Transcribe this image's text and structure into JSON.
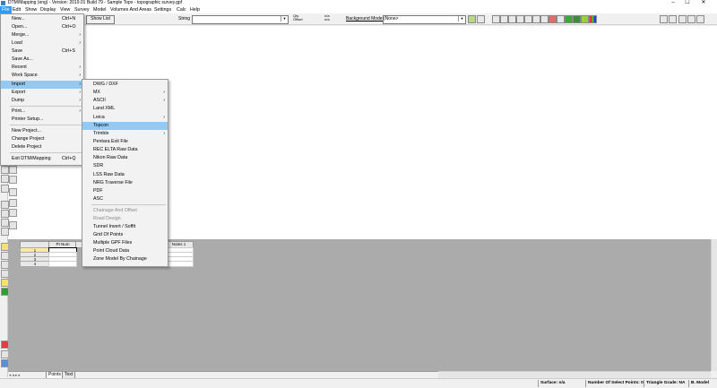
{
  "window": {
    "title": "DTM/Mapping (eng) - Version: 2019.01 Build 79 - Sample Topo - topographic survey.gpf",
    "minimize": "–",
    "maximize": "☐",
    "close": "✕"
  },
  "menubar": [
    "File",
    "Edit",
    "Show",
    "Display",
    "View",
    "Survey",
    "Model",
    "Volumes And Areas",
    "Settings",
    "Calc",
    "Help"
  ],
  "toolbar": {
    "show_list": "Show List",
    "string_label": "String",
    "string_value": "",
    "offset_label_top": "Qty",
    "offset_label_bottom": "Offset",
    "na_top": "n/a",
    "na_bottom": "n/a",
    "background_model_label": "Background Model",
    "background_model_value": "(None>"
  },
  "file_menu": [
    {
      "label": "New...",
      "shortcut": "Ctrl+N"
    },
    {
      "label": "Open...",
      "shortcut": "Ctrl+O"
    },
    {
      "label": "Merge...",
      "arrow": "›"
    },
    {
      "label": "Load",
      "arrow": "›"
    },
    {
      "label": "Save",
      "shortcut": "Ctrl+S"
    },
    {
      "label": "Save As..."
    },
    {
      "label": "Recent",
      "arrow": "›"
    },
    {
      "label": "Work Space",
      "arrow": "›"
    },
    {
      "label": "Import",
      "arrow": "›",
      "highlight": true
    },
    {
      "label": "Export",
      "arrow": "›"
    },
    {
      "label": "Dump",
      "arrow": "›"
    },
    {
      "label": "Print...",
      "arrow": "›"
    },
    {
      "label": "Printer Setup..."
    },
    {
      "label": "New Project..."
    },
    {
      "label": "Change Project"
    },
    {
      "label": "Delete Project"
    },
    {
      "label": "Exit DTM/Mapping",
      "shortcut": "Ctrl+Q"
    }
  ],
  "import_menu": [
    {
      "label": "DWG / DXF"
    },
    {
      "label": "MX",
      "arrow": "›"
    },
    {
      "label": "ASCII",
      "arrow": "›"
    },
    {
      "label": "Land XML"
    },
    {
      "label": "Leica",
      "arrow": "›"
    },
    {
      "label": "Topcon",
      "highlight": true
    },
    {
      "label": "Trimble",
      "arrow": "›"
    },
    {
      "label": "Pentara Exit File"
    },
    {
      "label": "REC ELTA Raw Data"
    },
    {
      "label": "Nikon Raw Data"
    },
    {
      "label": "SDR"
    },
    {
      "label": "LSS Raw Data"
    },
    {
      "label": "NRG Traverse File"
    },
    {
      "label": "PDF"
    },
    {
      "label": "ASC"
    },
    {
      "label": "Chainage And Offset",
      "disabled": true
    },
    {
      "label": "Road Design",
      "disabled": true
    },
    {
      "label": "Tunnel Invert / Soffit"
    },
    {
      "label": "Grid Of Points"
    },
    {
      "label": "Multiple GPF Files"
    },
    {
      "label": "Point Cloud Data"
    },
    {
      "label": "Zone Model By Chainage"
    }
  ],
  "grid": {
    "col_pt_num": "Pt Num",
    "col_notes": "Notes 1",
    "rows": [
      "1",
      "2",
      "3",
      "4"
    ]
  },
  "tabs": {
    "nav": "◂ ◂ ▸ ▸",
    "points": "Points",
    "text": "Text"
  },
  "status": {
    "surface": "Surface: n/a",
    "select_points": "Number Of Select Points: 0",
    "triangle": "Triangle Grade: NA",
    "model": "B. Model"
  },
  "colors": {
    "highlight": "#91c9f7",
    "menu_active": "#3399ff",
    "grid_bg": "#ababab"
  }
}
